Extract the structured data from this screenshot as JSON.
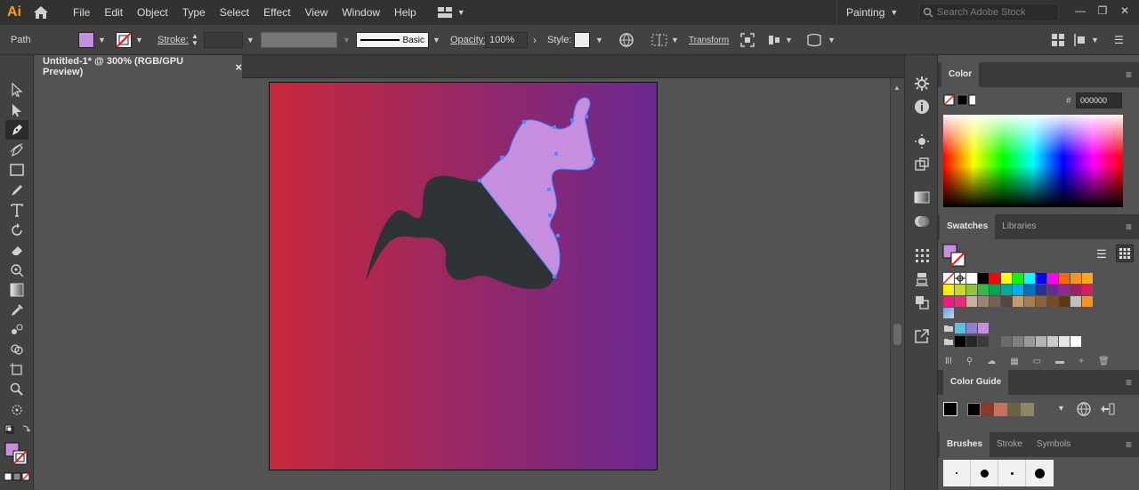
{
  "app": {
    "logo": "Ai"
  },
  "menu": [
    "File",
    "Edit",
    "Object",
    "Type",
    "Select",
    "Effect",
    "View",
    "Window",
    "Help"
  ],
  "workspace": {
    "label": "Painting"
  },
  "search": {
    "placeholder": "Search Adobe Stock"
  },
  "control": {
    "selection_label": "Path",
    "stroke_label": "Stroke:",
    "brush_label": "Basic",
    "opacity_label": "Opacity:",
    "opacity_value": "100%",
    "style_label": "Style:",
    "transform_label": "Transform"
  },
  "document": {
    "tab_title": "Untitled-1* @ 300% (RGB/GPU Preview)",
    "close": "×"
  },
  "panels": {
    "color": {
      "title": "Color",
      "hash": "#",
      "hex_value": "000000"
    },
    "swatches": {
      "tab1": "Swatches",
      "tab2": "Libraries"
    },
    "color_guide": {
      "title": "Color Guide"
    },
    "brushes": {
      "tab1": "Brushes",
      "tab2": "Stroke",
      "tab3": "Symbols"
    }
  },
  "colors": {
    "fill": "#c78ee0",
    "shape_light": "#c78ee0",
    "shape_dark": "#2e3436",
    "gradient_start": "#c7283a",
    "gradient_end": "#6a2890",
    "accent": "#ff9a00"
  },
  "icons": [
    "home-icon",
    "search-icon",
    "gear-icon",
    "info-icon",
    "globe-icon"
  ]
}
